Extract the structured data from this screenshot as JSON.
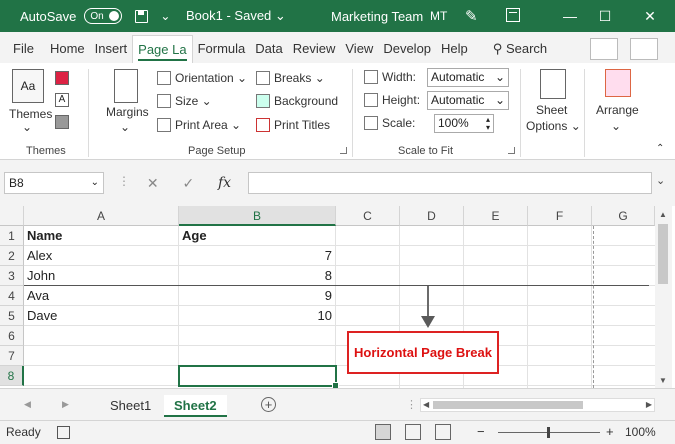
{
  "titlebar": {
    "autosave_label": "AutoSave",
    "autosave_state": "On",
    "doc_title": "Book1  -  Saved",
    "dropdown_glyph": "⌄",
    "team": "Marketing Team",
    "initials": "MT",
    "accent": "#217346"
  },
  "tabs": [
    {
      "label": "File"
    },
    {
      "label": "Home"
    },
    {
      "label": "Insert"
    },
    {
      "label": "Page La"
    },
    {
      "label": "Formula"
    },
    {
      "label": "Data"
    },
    {
      "label": "Review"
    },
    {
      "label": "View"
    },
    {
      "label": "Develop"
    },
    {
      "label": "Help"
    }
  ],
  "active_tab": "Page La",
  "search_label": "Search",
  "ribbon": {
    "themes": {
      "themes_label": "Themes",
      "group": "Themes"
    },
    "page_setup": {
      "margins": "Margins",
      "orientation": "Orientation",
      "size": "Size",
      "print_area": "Print Area",
      "breaks": "Breaks",
      "background": "Background",
      "print_titles": "Print Titles",
      "group": "Page Setup"
    },
    "scale_to_fit": {
      "width_label": "Width:",
      "width_value": "Automatic",
      "height_label": "Height:",
      "height_value": "Automatic",
      "scale_label": "Scale:",
      "scale_value": "100%",
      "group": "Scale to Fit"
    },
    "sheet_options": {
      "label_1": "Sheet",
      "label_2": "Options"
    },
    "arrange": {
      "label": "Arrange"
    }
  },
  "formula_bar": {
    "name_box": "B8",
    "cancel": "✕",
    "enter": "✓",
    "fx": "fx",
    "value": ""
  },
  "columns": [
    "A",
    "B",
    "C",
    "D",
    "E",
    "F",
    "G"
  ],
  "rows": [
    "1",
    "2",
    "3",
    "4",
    "5",
    "6",
    "7",
    "8"
  ],
  "cells": {
    "A1": "Name",
    "B1": "Age",
    "A2": "Alex",
    "B2": "7",
    "A3": "John",
    "B3": "8",
    "A4": "Ava",
    "B4": "9",
    "A5": "Dave",
    "B5": "10"
  },
  "selected_cell": "B8",
  "callout": "Horizontal Page Break",
  "sheets": [
    {
      "name": "Sheet1",
      "active": false
    },
    {
      "name": "Sheet2",
      "active": true
    }
  ],
  "add_sheet": "+",
  "status": {
    "ready": "Ready",
    "zoom_minus": "−",
    "zoom_plus": "+",
    "zoom": "100%"
  }
}
